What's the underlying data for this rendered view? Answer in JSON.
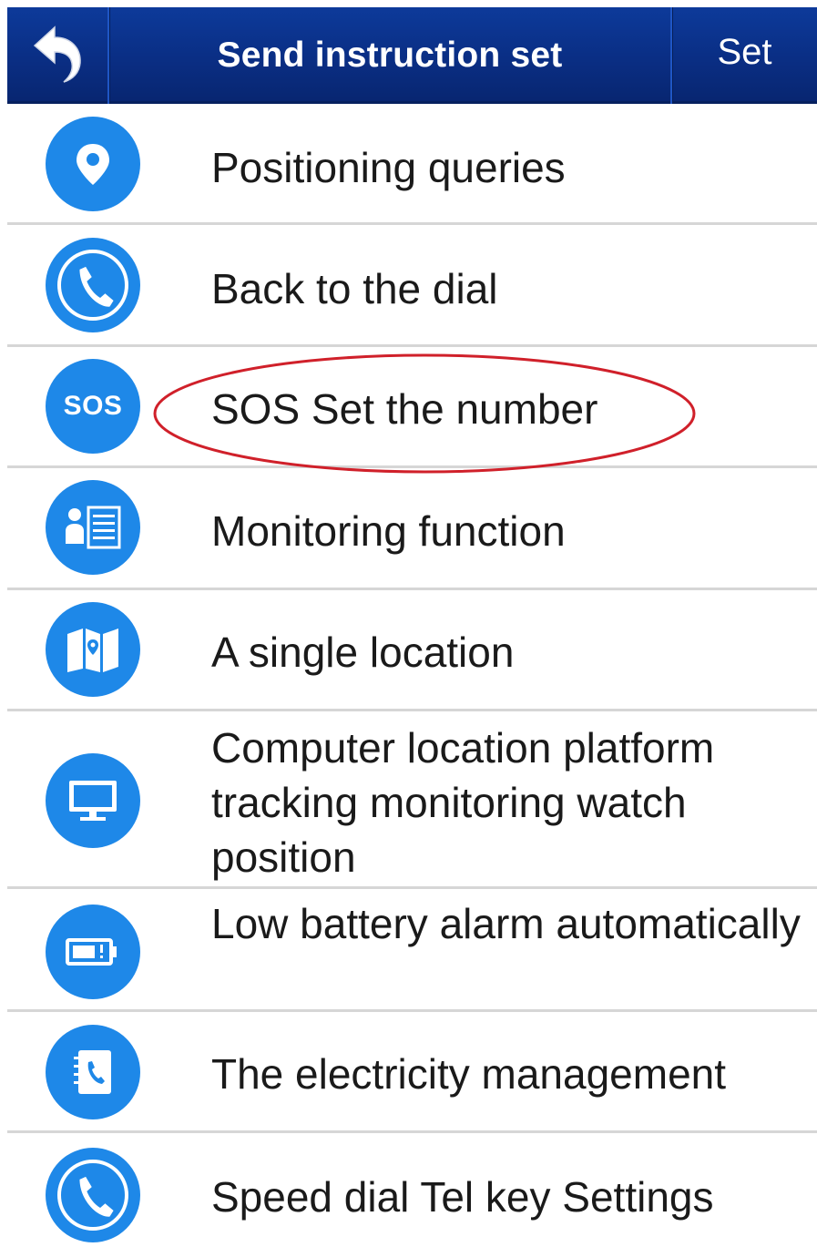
{
  "header": {
    "title": "Send instruction set",
    "set_label": "Set"
  },
  "colors": {
    "header_bg": "#0a2e84",
    "icon_blue": "#1e88e8",
    "annotation_red": "#d0202a"
  },
  "items": [
    {
      "label": "Positioning queries",
      "icon": "location-pin-icon"
    },
    {
      "label": "Back to the dial",
      "icon": "phone-icon"
    },
    {
      "label": "SOS Set the number",
      "icon": "sos-icon",
      "icon_text": "SOS",
      "highlighted": true
    },
    {
      "label": "Monitoring function",
      "icon": "contact-list-icon"
    },
    {
      "label": "A single location",
      "icon": "map-icon"
    },
    {
      "label": "Computer location platform tracking monitoring watch position",
      "icon": "monitor-icon"
    },
    {
      "label": "Low battery alarm automatically",
      "icon": "battery-icon"
    },
    {
      "label": "The electricity management",
      "icon": "phonebook-icon"
    },
    {
      "label": "Speed dial Tel key Settings",
      "icon": "phone-icon"
    }
  ]
}
